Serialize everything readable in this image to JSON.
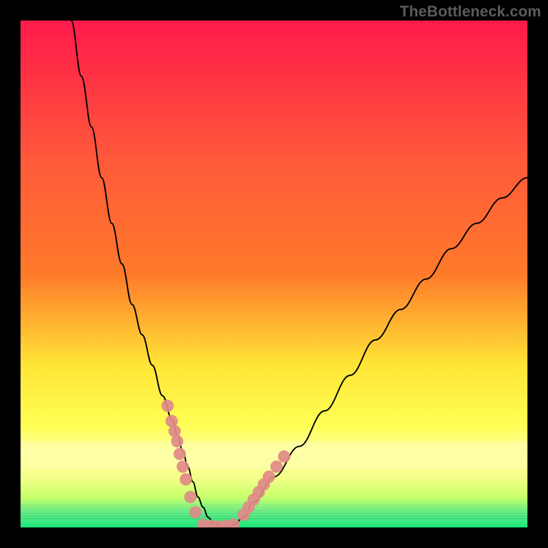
{
  "watermark": "TheBottleneck.com",
  "chart_data": {
    "type": "line",
    "title": "",
    "xlabel": "",
    "ylabel": "",
    "xlim": [
      0,
      100
    ],
    "ylim": [
      0,
      100
    ],
    "grid": false,
    "legend": false,
    "background_gradient": {
      "top": "#ff1a4b",
      "mid1": "#ff7a2a",
      "mid2": "#ffe536",
      "band_light": "#ffff9e",
      "bottom": "#18e47a"
    },
    "series": [
      {
        "name": "curve",
        "color": "#000000",
        "x": [
          10,
          12,
          14,
          16,
          18,
          20,
          22,
          24,
          26,
          28,
          30,
          31,
          32,
          33,
          34,
          35,
          36,
          37,
          38,
          40,
          42,
          44,
          46,
          50,
          55,
          60,
          65,
          70,
          75,
          80,
          85,
          90,
          95,
          100
        ],
        "y": [
          100,
          89,
          79,
          69,
          60,
          52,
          44,
          38,
          32,
          26,
          21,
          18,
          15,
          12,
          9,
          6,
          4,
          2,
          1,
          0,
          0.5,
          2,
          5,
          10,
          16,
          23,
          30,
          37,
          43,
          49,
          55,
          60,
          65,
          69
        ]
      },
      {
        "name": "highlight-dots-left",
        "type": "scatter",
        "color": "#e08a88",
        "x": [
          29.0,
          29.8,
          30.4,
          30.9,
          31.4,
          32.0,
          32.6,
          33.5,
          34.5
        ],
        "y": [
          24.0,
          21.0,
          19.0,
          17.0,
          14.5,
          12.0,
          9.5,
          6.0,
          3.0
        ]
      },
      {
        "name": "highlight-dots-bottom",
        "type": "scatter",
        "color": "#e08a88",
        "x": [
          36.0,
          37.5,
          39.0,
          40.5,
          42.0
        ],
        "y": [
          0.5,
          0.3,
          0.2,
          0.3,
          0.6
        ]
      },
      {
        "name": "highlight-dots-right",
        "type": "scatter",
        "color": "#e08a88",
        "x": [
          44.0,
          45.0,
          46.0,
          47.0,
          48.0,
          49.0,
          50.5,
          52.0
        ],
        "y": [
          2.5,
          4.0,
          5.5,
          7.0,
          8.5,
          10.0,
          12.0,
          14.0
        ]
      }
    ]
  }
}
